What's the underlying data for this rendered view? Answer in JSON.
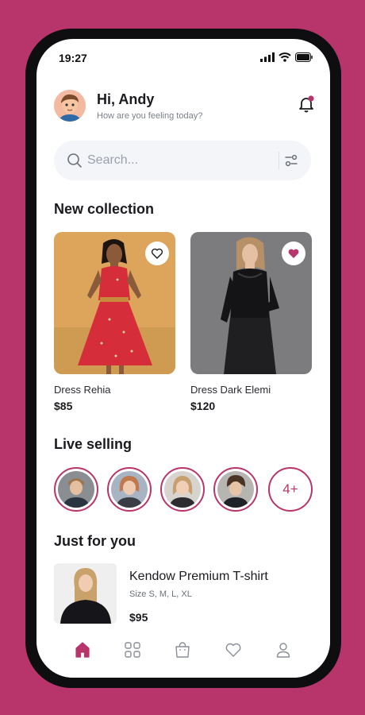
{
  "status_bar": {
    "time": "19:27"
  },
  "header": {
    "greeting": "Hi, Andy",
    "subtitle": "How are you feeling today?",
    "has_notification": true
  },
  "search": {
    "placeholder": "Search..."
  },
  "new_collection": {
    "title": "New collection",
    "items": [
      {
        "name": "Dress Rehia",
        "price": "$85",
        "favorited": false
      },
      {
        "name": "Dress Dark Elemi",
        "price": "$120",
        "favorited": true
      }
    ]
  },
  "live_selling": {
    "title": "Live selling",
    "more_label": "4+"
  },
  "just_for_you": {
    "title": "Just for you",
    "item": {
      "name": "Kendow Premium T-shirt",
      "sizes": "Size S, M, L, XL",
      "price": "$95"
    }
  },
  "tabbar": {
    "items": [
      "home-icon",
      "grid-icon",
      "bag-icon",
      "heart-icon",
      "profile-icon"
    ],
    "active": "home-icon"
  },
  "colors": {
    "accent": "#b8356b",
    "background": "#b8356b",
    "search_bg": "#f3f5f9"
  }
}
